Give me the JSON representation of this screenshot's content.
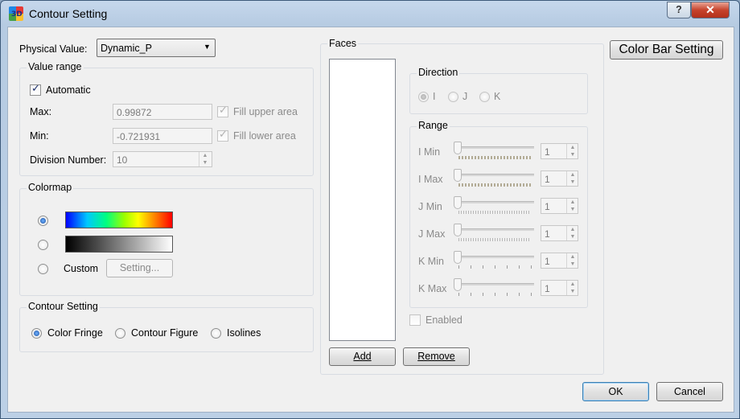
{
  "window": {
    "title": "Contour Setting",
    "icon_text": "3D",
    "help_glyph": "?",
    "close_glyph": "✕"
  },
  "physical_value": {
    "label": "Physical Value:",
    "selected": "Dynamic_P"
  },
  "value_range": {
    "title": "Value range",
    "automatic_label": "Automatic",
    "max_label": "Max:",
    "max_value": "0.99872",
    "min_label": "Min:",
    "min_value": "-0.721931",
    "fill_upper_label": "Fill upper area",
    "fill_lower_label": "Fill lower area",
    "division_label": "Division Number:",
    "division_value": "10"
  },
  "colormap": {
    "title": "Colormap",
    "custom_label": "Custom",
    "setting_button": "Setting..."
  },
  "contour_setting": {
    "title": "Contour Setting",
    "options": [
      "Color Fringe",
      "Contour Figure",
      "Isolines"
    ]
  },
  "faces": {
    "title": "Faces",
    "add_button": "Add",
    "remove_button": "Remove",
    "enabled_label": "Enabled"
  },
  "direction": {
    "title": "Direction",
    "options": [
      "I",
      "J",
      "K"
    ]
  },
  "range": {
    "title": "Range",
    "rows": [
      {
        "label": "I Min",
        "value": "1"
      },
      {
        "label": "I Max",
        "value": "1"
      },
      {
        "label": "J Min",
        "value": "1"
      },
      {
        "label": "J Max",
        "value": "1"
      },
      {
        "label": "K Min",
        "value": "1"
      },
      {
        "label": "K Max",
        "value": "1"
      }
    ]
  },
  "buttons": {
    "color_bar": "Color Bar Setting",
    "ok": "OK",
    "cancel": "Cancel"
  },
  "icons": {
    "combo": "chevron-down-icon",
    "spin_up": "spin-up-icon",
    "spin_down": "spin-down-icon",
    "check": "check-icon"
  }
}
